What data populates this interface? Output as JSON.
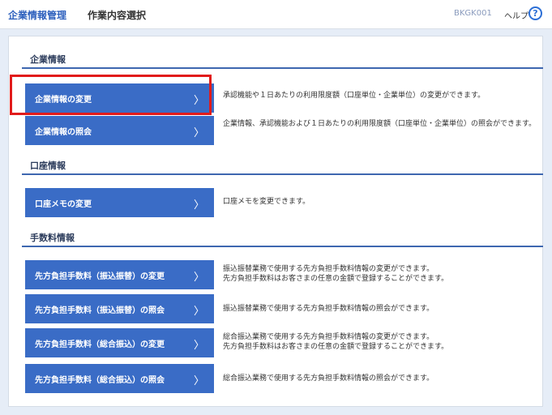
{
  "header": {
    "breadcrumb_1": "企業情報管理",
    "breadcrumb_2": "作業内容選択",
    "screen_id": "BKGK001",
    "help_label": "ヘルプ",
    "help_icon": "question-circle-icon",
    "help_icon_glyph": "?"
  },
  "sections": [
    {
      "title": "企業情報",
      "items": [
        {
          "label": "企業情報の変更",
          "desc": "承認機能や１日あたりの利用限度額（口座単位・企業単位）の変更ができます。",
          "highlighted": true
        },
        {
          "label": "企業情報の照会",
          "desc": "企業情報、承認機能および１日あたりの利用限度額（口座単位・企業単位）の照会ができます。",
          "highlighted": false
        }
      ]
    },
    {
      "title": "口座情報",
      "items": [
        {
          "label": "口座メモの変更",
          "desc": "口座メモを変更できます。",
          "highlighted": false
        }
      ]
    },
    {
      "title": "手数料情報",
      "items": [
        {
          "label": "先方負担手数料（振込振替）の変更",
          "desc": "振込振替業務で使用する先方負担手数料情報の変更ができます。\n先方負担手数料はお客さまの任意の金額で登録することができます。",
          "highlighted": false
        },
        {
          "label": "先方負担手数料（振込振替）の照会",
          "desc": "振込振替業務で使用する先方負担手数料情報の照会ができます。",
          "highlighted": false
        },
        {
          "label": "先方負担手数料（総合振込）の変更",
          "desc": "総合振込業務で使用する先方負担手数料情報の変更ができます。\n先方負担手数料はお客さまの任意の金額で登録することができます。",
          "highlighted": false
        },
        {
          "label": "先方負担手数料（総合振込）の照会",
          "desc": "総合振込業務で使用する先方負担手数料情報の照会ができます。",
          "highlighted": false
        }
      ]
    }
  ],
  "chevron_glyph": "〉",
  "chevron_icon": "chevron-right-icon",
  "colors": {
    "accent": "#3a6cc6",
    "highlight": "#e11b1b",
    "background": "#e6edf7"
  }
}
